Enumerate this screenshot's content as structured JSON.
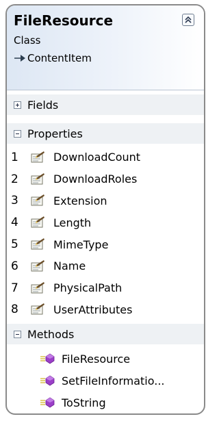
{
  "class_box": {
    "name": "FileResource",
    "stereotype": "Class",
    "base_class": "ContentItem",
    "collapse_icon": "double-chevron-up-icon",
    "colors": {
      "border": "#8a8a8a",
      "header_start": "#dde7f4",
      "section_bg": "#eef1f4"
    }
  },
  "sections": {
    "fields": {
      "label": "Fields",
      "expanded": false
    },
    "properties": {
      "label": "Properties",
      "expanded": true
    },
    "methods": {
      "label": "Methods",
      "expanded": true
    }
  },
  "properties": [
    {
      "index": "1",
      "name": "DownloadCount",
      "icon": "property-icon"
    },
    {
      "index": "2",
      "name": "DownloadRoles",
      "icon": "property-icon"
    },
    {
      "index": "3",
      "name": "Extension",
      "icon": "property-icon"
    },
    {
      "index": "4",
      "name": "Length",
      "icon": "property-icon"
    },
    {
      "index": "5",
      "name": "MimeType",
      "icon": "property-icon"
    },
    {
      "index": "6",
      "name": "Name",
      "icon": "property-icon"
    },
    {
      "index": "7",
      "name": "PhysicalPath",
      "icon": "property-icon"
    },
    {
      "index": "8",
      "name": "UserAttributes",
      "icon": "property-icon"
    }
  ],
  "methods": [
    {
      "name": "FileResource",
      "icon": "method-icon"
    },
    {
      "name": "SetFileInformatio...",
      "icon": "method-icon"
    },
    {
      "name": "ToString",
      "icon": "method-icon"
    }
  ]
}
